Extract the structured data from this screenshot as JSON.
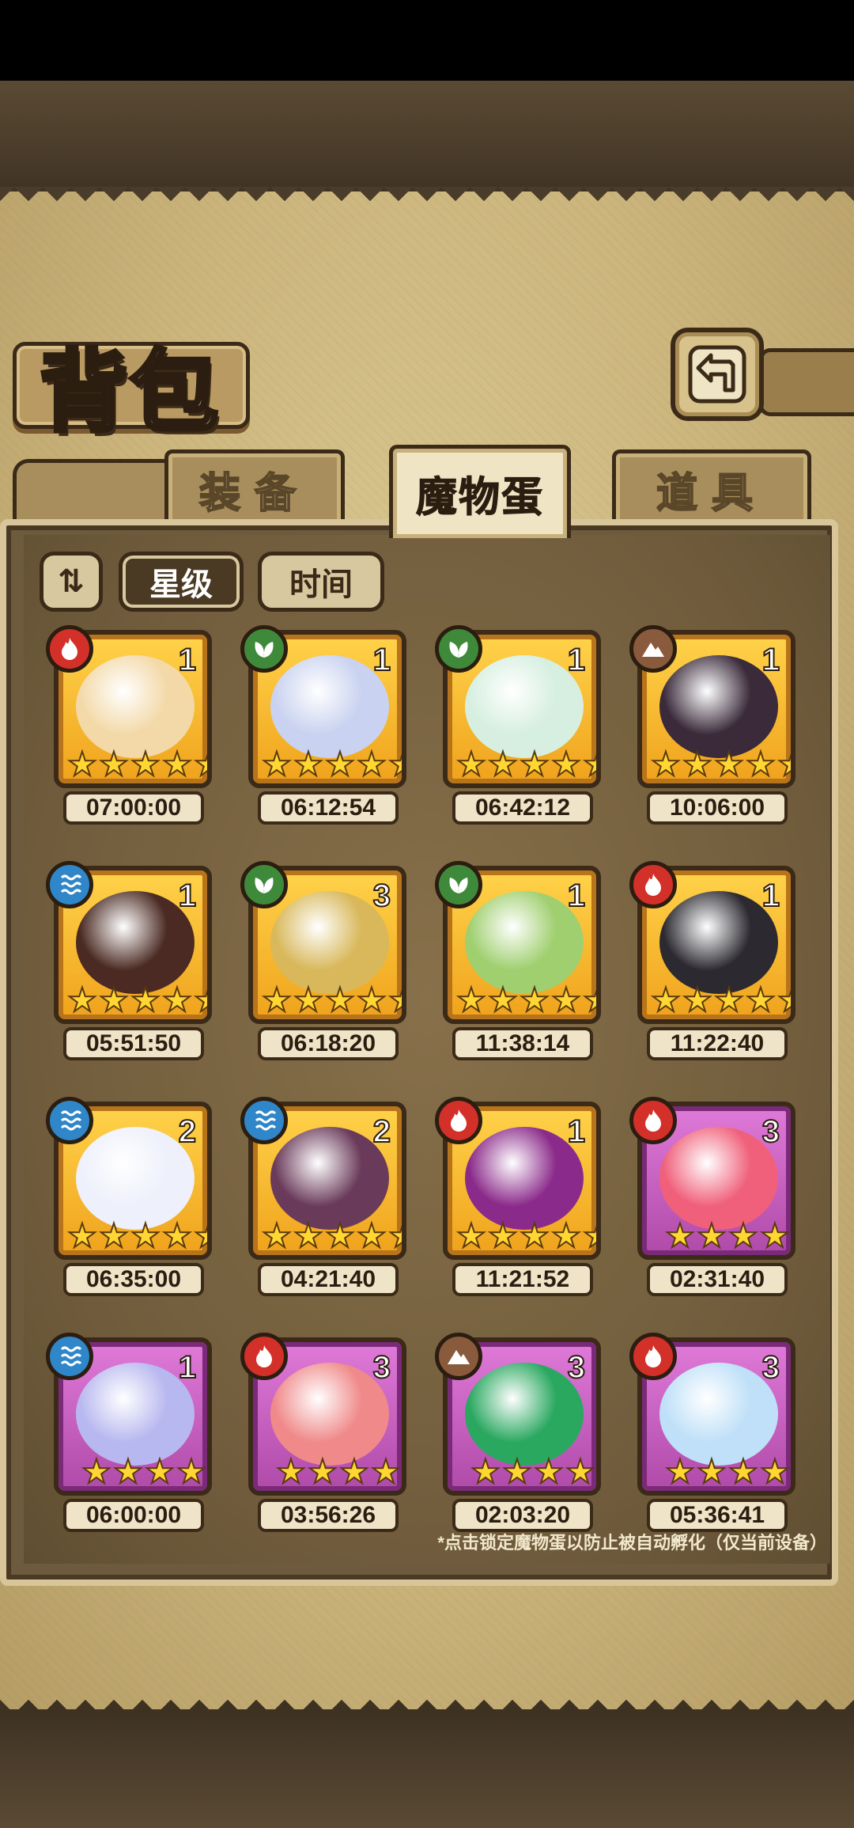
{
  "title": "背包",
  "tabs": [
    {
      "label": "装备",
      "active": false
    },
    {
      "label": "魔物蛋",
      "active": true
    },
    {
      "label": "道具",
      "active": false
    }
  ],
  "sort": {
    "toggle_icon": "sort-toggle-icon",
    "buttons": [
      {
        "label": "星级",
        "active": true
      },
      {
        "label": "时间",
        "active": false
      }
    ]
  },
  "eggs": [
    {
      "element": "fire",
      "count": "1",
      "stars": 5,
      "frame": "gold",
      "timer": "07:00:00",
      "art": "#f3d9a8"
    },
    {
      "element": "grass",
      "count": "1",
      "stars": 5,
      "frame": "gold",
      "timer": "06:12:54",
      "art": "#c9d2f0"
    },
    {
      "element": "grass",
      "count": "1",
      "stars": 5,
      "frame": "gold",
      "timer": "06:42:12",
      "art": "#d6efe0"
    },
    {
      "element": "earth",
      "count": "1",
      "stars": 5,
      "frame": "gold",
      "timer": "10:06:00",
      "art": "#3a2a3a"
    },
    {
      "element": "water",
      "count": "1",
      "stars": 5,
      "frame": "gold",
      "timer": "05:51:50",
      "art": "#4a2a22"
    },
    {
      "element": "grass",
      "count": "3",
      "stars": 5,
      "frame": "gold",
      "timer": "06:18:20",
      "art": "#d8b85a"
    },
    {
      "element": "grass",
      "count": "1",
      "stars": 5,
      "frame": "gold",
      "timer": "11:38:14",
      "art": "#9fcf6e"
    },
    {
      "element": "fire",
      "count": "1",
      "stars": 5,
      "frame": "gold",
      "timer": "11:22:40",
      "art": "#2c2a30"
    },
    {
      "element": "water",
      "count": "2",
      "stars": 5,
      "frame": "gold",
      "timer": "06:35:00",
      "art": "#eef0fb"
    },
    {
      "element": "water",
      "count": "2",
      "stars": 5,
      "frame": "gold",
      "timer": "04:21:40",
      "art": "#6a3a5a"
    },
    {
      "element": "fire",
      "count": "1",
      "stars": 5,
      "frame": "gold",
      "timer": "11:21:52",
      "art": "#8a2a8a"
    },
    {
      "element": "fire",
      "count": "3",
      "stars": 4,
      "frame": "purple",
      "timer": "02:31:40",
      "art": "#f0607a"
    },
    {
      "element": "water",
      "count": "1",
      "stars": 4,
      "frame": "purple",
      "timer": "06:00:00",
      "art": "#b8b8f0"
    },
    {
      "element": "fire",
      "count": "3",
      "stars": 4,
      "frame": "purple",
      "timer": "03:56:26",
      "art": "#f08a8a"
    },
    {
      "element": "earth",
      "count": "3",
      "stars": 4,
      "frame": "purple",
      "timer": "02:03:20",
      "art": "#2aa860"
    },
    {
      "element": "fire",
      "count": "3",
      "stars": 4,
      "frame": "purple",
      "timer": "05:36:41",
      "art": "#bfe0f8"
    }
  ],
  "hint": "*点击锁定魔物蛋以防止被自动孵化（仅当前设备）"
}
